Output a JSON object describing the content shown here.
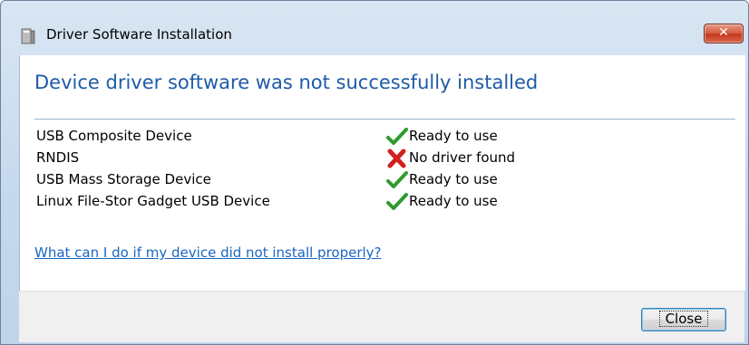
{
  "window": {
    "title": "Driver Software Installation",
    "close_glyph": "✕"
  },
  "headline": "Device driver software was not successfully installed",
  "devices": [
    {
      "name": "USB Composite Device",
      "status": "Ready to use",
      "status_icon": "green-check-icon"
    },
    {
      "name": "RNDIS",
      "status": "No driver found",
      "status_icon": "red-x-icon"
    },
    {
      "name": "USB Mass Storage Device",
      "status": "Ready to use",
      "status_icon": "green-check-icon"
    },
    {
      "name": "Linux File-Stor Gadget USB Device",
      "status": "Ready to use",
      "status_icon": "green-check-icon"
    }
  ],
  "help_link": "What can I do if my device did not install properly?",
  "footer": {
    "close_label": "Close"
  },
  "colors": {
    "headline": "#1e5ba6",
    "link": "#1a66c2",
    "success": "#2f9b2f",
    "error": "#d12020"
  }
}
